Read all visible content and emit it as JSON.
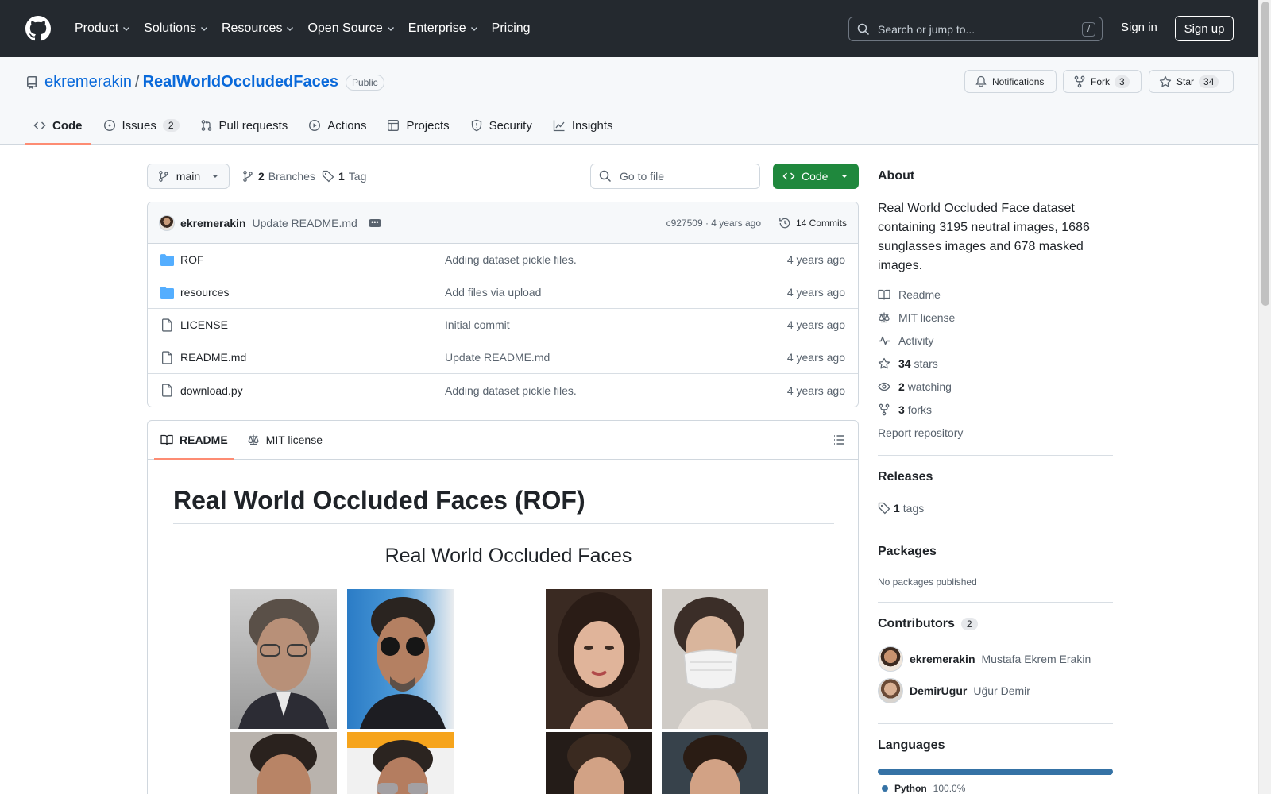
{
  "header": {
    "nav": [
      "Product",
      "Solutions",
      "Resources",
      "Open Source",
      "Enterprise",
      "Pricing"
    ],
    "search_placeholder": "Search or jump to...",
    "search_shortcut": "/",
    "signin": "Sign in",
    "signup": "Sign up"
  },
  "repo": {
    "owner": "ekremerakin",
    "separator": "/",
    "name": "RealWorldOccludedFaces",
    "visibility": "Public",
    "notifications_label": "Notifications",
    "fork_label": "Fork",
    "fork_count": "3",
    "star_label": "Star",
    "star_count": "34"
  },
  "tabs": [
    {
      "label": "Code",
      "icon": "code-icon",
      "active": true
    },
    {
      "label": "Issues",
      "icon": "issue-icon",
      "count": "2"
    },
    {
      "label": "Pull requests",
      "icon": "pull-request-icon"
    },
    {
      "label": "Actions",
      "icon": "play-icon"
    },
    {
      "label": "Projects",
      "icon": "table-icon"
    },
    {
      "label": "Security",
      "icon": "shield-icon"
    },
    {
      "label": "Insights",
      "icon": "graph-icon"
    }
  ],
  "toolbar": {
    "branch": "main",
    "branches_count": "2",
    "branches_label": "Branches",
    "tags_count": "1",
    "tags_label": "Tag",
    "goto_placeholder": "Go to file",
    "code_label": "Code"
  },
  "commit": {
    "author": "ekremerakin",
    "message": "Update README.md",
    "ellipsis": "•••",
    "hash_age": "c927509 · 4 years ago",
    "commits": "14 Commits"
  },
  "files": [
    {
      "type": "folder",
      "name": "ROF",
      "message": "Adding dataset pickle files.",
      "age": "4 years ago"
    },
    {
      "type": "folder",
      "name": "resources",
      "message": "Add files via upload",
      "age": "4 years ago"
    },
    {
      "type": "file",
      "name": "LICENSE",
      "message": "Initial commit",
      "age": "4 years ago"
    },
    {
      "type": "file",
      "name": "README.md",
      "message": "Update README.md",
      "age": "4 years ago"
    },
    {
      "type": "file",
      "name": "download.py",
      "message": "Adding dataset pickle files.",
      "age": "4 years ago"
    }
  ],
  "readme": {
    "tab_readme": "README",
    "tab_license": "MIT license",
    "title": "Real World Occluded Faces (ROF)",
    "figure_title": "Real World Occluded Faces"
  },
  "sidebar": {
    "about_title": "About",
    "description": "Real World Occluded Face dataset containing 3195 neutral images, 1686 sunglasses images and 678 masked images.",
    "links": [
      {
        "icon": "book-icon",
        "label": "Readme"
      },
      {
        "icon": "law-icon",
        "label": "MIT license"
      },
      {
        "icon": "pulse-icon",
        "label": "Activity"
      },
      {
        "icon": "star-icon",
        "bold": "34",
        "label": "stars"
      },
      {
        "icon": "eye-icon",
        "bold": "2",
        "label": "watching"
      },
      {
        "icon": "fork-icon",
        "bold": "3",
        "label": "forks"
      }
    ],
    "report": "Report repository",
    "releases_title": "Releases",
    "releases_tags_count": "1",
    "releases_tags_label": "tags",
    "packages_title": "Packages",
    "packages_empty": "No packages published",
    "contributors_title": "Contributors",
    "contributors_count": "2",
    "contributors": [
      {
        "login": "ekremerakin",
        "name": "Mustafa Ekrem Erakin"
      },
      {
        "login": "DemirUgur",
        "name": "Uğur Demir"
      }
    ],
    "languages_title": "Languages",
    "language": {
      "name": "Python",
      "percent": "100.0%",
      "color": "#3572a5"
    }
  },
  "colors": {
    "header_bg": "#24292f",
    "link": "#0969da",
    "primary_button": "#1f883d",
    "active_tab_underline": "#fd8c73",
    "folder_icon": "#54aeff"
  }
}
